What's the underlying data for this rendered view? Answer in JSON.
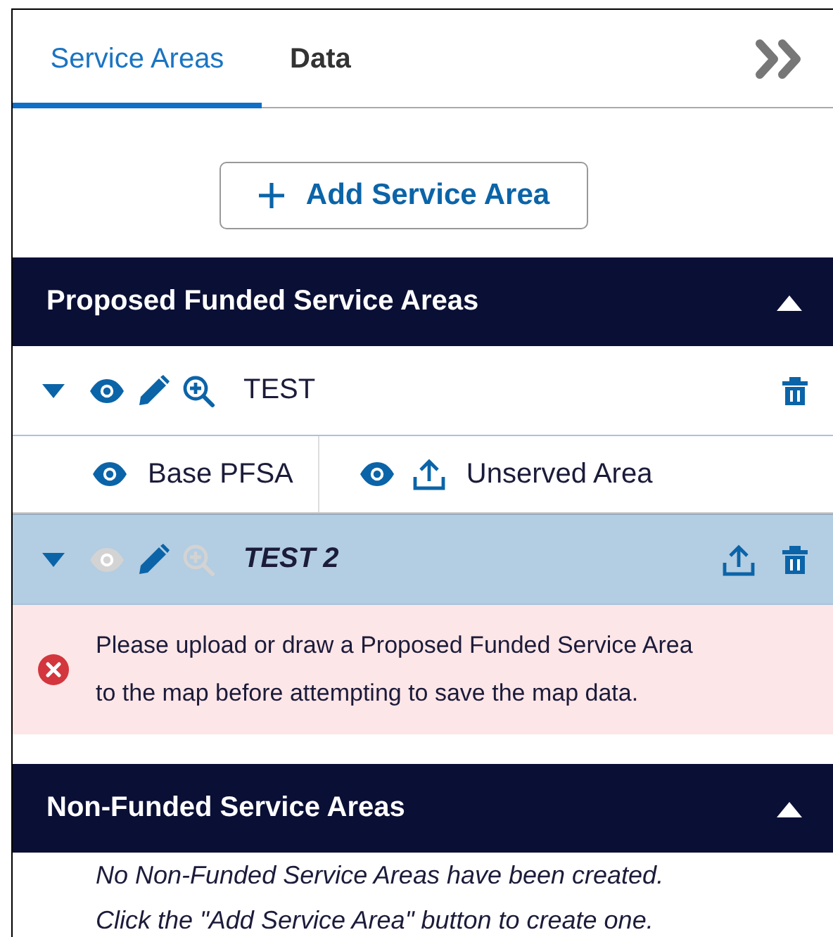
{
  "tabs": [
    {
      "label": "Service Areas",
      "selected": true
    },
    {
      "label": "Data",
      "selected": false
    }
  ],
  "add_button": {
    "label": "Add Service Area"
  },
  "sections": [
    {
      "title": "Proposed Funded Service Areas",
      "expanded": true,
      "items": [
        {
          "name": "TEST",
          "expanded": true,
          "selected": false,
          "visible": true,
          "zoom_enabled": true,
          "upload_available": false,
          "layers": [
            {
              "name": "Base PFSA",
              "visible": true,
              "upload_available": false
            },
            {
              "name": "Unserved Area",
              "visible": true,
              "upload_available": true
            }
          ]
        },
        {
          "name": "TEST 2",
          "expanded": true,
          "selected": true,
          "visible": false,
          "zoom_enabled": false,
          "upload_available": true
        }
      ],
      "alert": {
        "kind": "error",
        "text": "Please upload or draw a Proposed Funded Service Area to the map before attempting to save the map data."
      }
    },
    {
      "title": "Non-Funded Service Areas",
      "expanded": true,
      "empty_message": [
        "No Non-Funded Service Areas have been created.",
        "Click the \"Add Service Area\" button to create one."
      ]
    }
  ]
}
